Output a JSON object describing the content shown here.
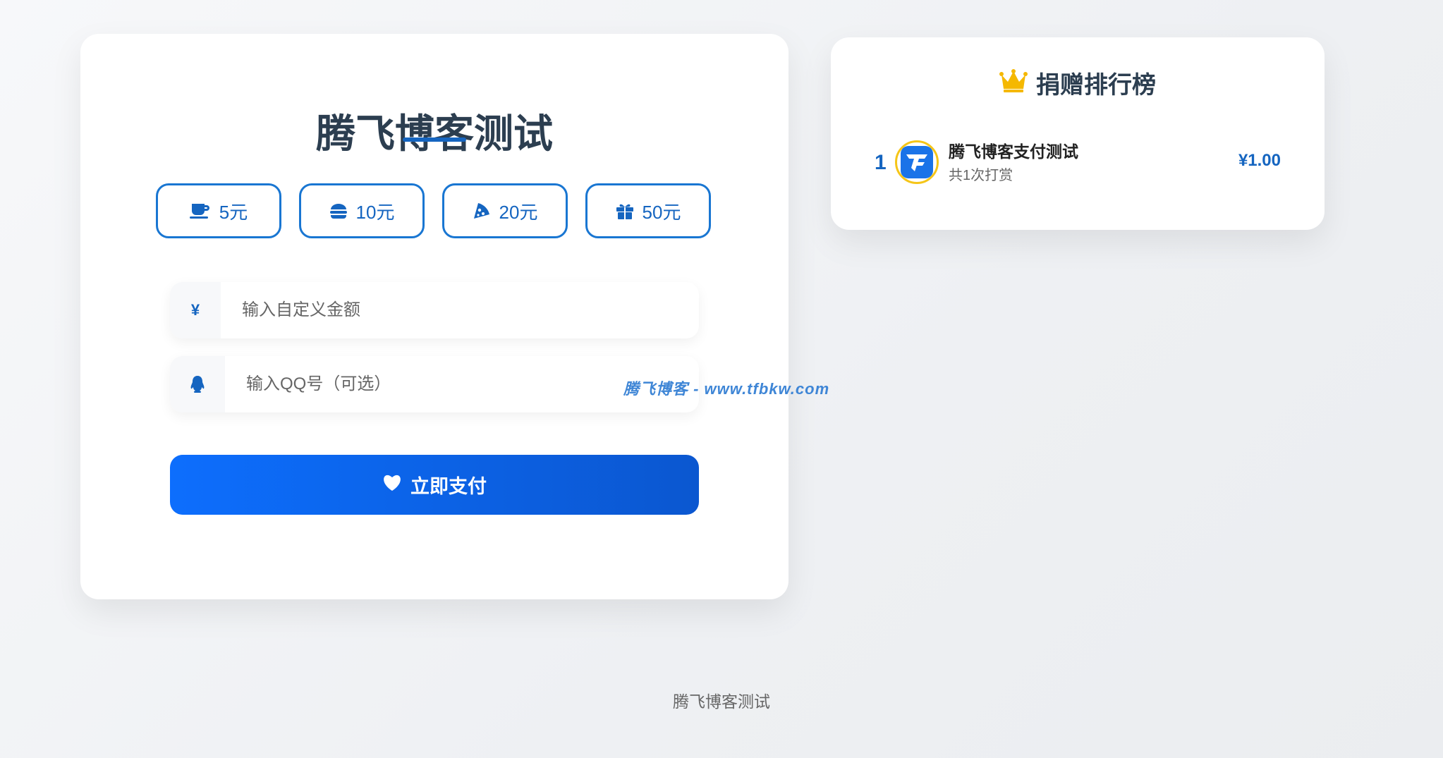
{
  "main": {
    "title": "腾飞博客测试",
    "amount_options": [
      {
        "label": "5元",
        "icon": "coffee-icon"
      },
      {
        "label": "10元",
        "icon": "burger-icon"
      },
      {
        "label": "20元",
        "icon": "pizza-icon"
      },
      {
        "label": "50元",
        "icon": "gift-icon"
      }
    ],
    "custom_amount": {
      "prefix": "¥",
      "value": "",
      "placeholder": "输入自定义金额"
    },
    "qq": {
      "icon": "qq-penguin-icon",
      "value": "",
      "placeholder": "输入QQ号（可选）"
    },
    "pay_button": {
      "label": "立即支付",
      "icon": "heart-icon"
    }
  },
  "ranking": {
    "title": "捐赠排行榜",
    "icon": "crown-icon",
    "items": [
      {
        "rank": "1",
        "name": "腾飞博客支付测试",
        "count": "共1次打赏",
        "amount": "¥1.00",
        "avatar_icon": "tf-logo-avatar-icon"
      }
    ]
  },
  "watermark": "腾飞博客 - www.tfbkw.com",
  "footer": {
    "text": "腾飞博客测试"
  },
  "colors": {
    "accent": "#1565c0",
    "button_gradient_start": "#0d6efd",
    "button_gradient_end": "#0b57d0",
    "crown": "#f5b800",
    "title": "#2c3e50"
  }
}
